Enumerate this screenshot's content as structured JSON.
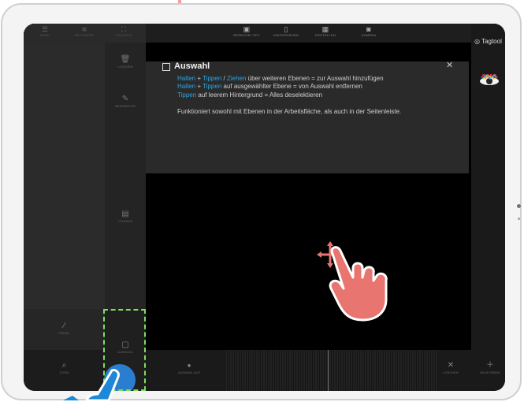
{
  "topbar": {
    "left_items": [
      {
        "icon": "menu-icon",
        "label": "MENÜ"
      },
      {
        "icon": "wifi-icon",
        "label": "NETZWERK"
      },
      {
        "icon": "fullscreen-icon",
        "label": "VOLLBILD"
      }
    ],
    "right_items": [
      {
        "icon": "image-icon",
        "label": "BEREICHE OPT"
      },
      {
        "icon": "document-icon",
        "label": "HINTERGRUND"
      },
      {
        "icon": "grid-icon",
        "label": "ERSTELLEN"
      },
      {
        "icon": "camera-icon",
        "label": "KAMERA"
      }
    ]
  },
  "sidebar": {
    "items": [
      {
        "icon": "trash-icon",
        "label": "LÖSCHEN"
      },
      {
        "icon": "edit-icon",
        "label": "BEARBEITEN"
      },
      {
        "icon": "toolbox-icon",
        "label": "TOOLBOX"
      }
    ],
    "brush_label": "PINSEL",
    "selection_label": "AUSWAHL",
    "zoom_label": "ZOOM"
  },
  "brand": {
    "logo": "Tagtool"
  },
  "dialog": {
    "title": "Auswahl",
    "line1_a": "Halten",
    "line1_b": " + ",
    "line1_c": "Tippen",
    "line1_d": " / ",
    "line1_e": "Ziehen",
    "line1_f": " über weiteren Ebenen = zur Auswahl hinzufügen",
    "line2_a": "Halten",
    "line2_b": " + ",
    "line2_c": "Tippen",
    "line2_d": " auf ausgewählter Ebene = von Auswahl entfernen",
    "line3_a": "Tippen",
    "line3_b": " auf leerem Hintergrund = Alles deselektieren",
    "line4": "Funktioniert sowohl mit Ebenen in der Arbeitsfläche, als auch in der Seitenleiste."
  },
  "bottombar": {
    "left_label": "AUSWAHL AUF",
    "delete_label": "LÖSCHEN",
    "new_label": "NEUE EBENE"
  },
  "colors": {
    "accent": "#2aa7e3",
    "highlight_dashed": "#7de05c",
    "button": "#2a7ed0",
    "hand": "#e8756f"
  }
}
